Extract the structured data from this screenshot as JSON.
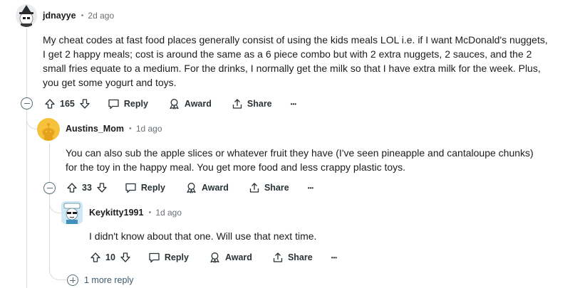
{
  "comments": [
    {
      "author": "jdnayye",
      "time": "2d ago",
      "body": "My cheat codes at fast food places generally consist of using the kids meals LOL i.e. if I want McDonald's nuggets, I get 2 happy meals; cost is around the same as a 6 piece combo but with 2 extra nuggets, 2 sauces, and the 2 small fries equate to a medium. For the drinks, I normally get the milk so that I have extra milk for the week. Plus, you get some yogurt and toys.",
      "votes": "165"
    },
    {
      "author": "Austins_Mom",
      "time": "1d ago",
      "body": "You can also sub the apple slices or whatever fruit they have (I've seen pineapple and cantaloupe chunks) for the toy in the happy meal. You get more food and less crappy plastic toys.",
      "votes": "33"
    },
    {
      "author": "Keykitty1991",
      "time": "1d ago",
      "body": "I didn't know about that one. Will use that next time.",
      "votes": "10"
    }
  ],
  "actions": {
    "reply": "Reply",
    "award": "Award",
    "share": "Share",
    "more": "•••"
  },
  "separator": "•",
  "more_replies": "1 more reply",
  "colors": {
    "text": "#1c1c1c",
    "muted": "#6a6f74",
    "thread_line": "#d8dadc",
    "action": "#2a3236",
    "snoo_avatar_bg": "#f6c13b"
  },
  "icons": [
    "upvote-icon",
    "downvote-icon",
    "reply-icon",
    "award-icon",
    "share-icon",
    "collapse-icon",
    "expand-icon"
  ]
}
